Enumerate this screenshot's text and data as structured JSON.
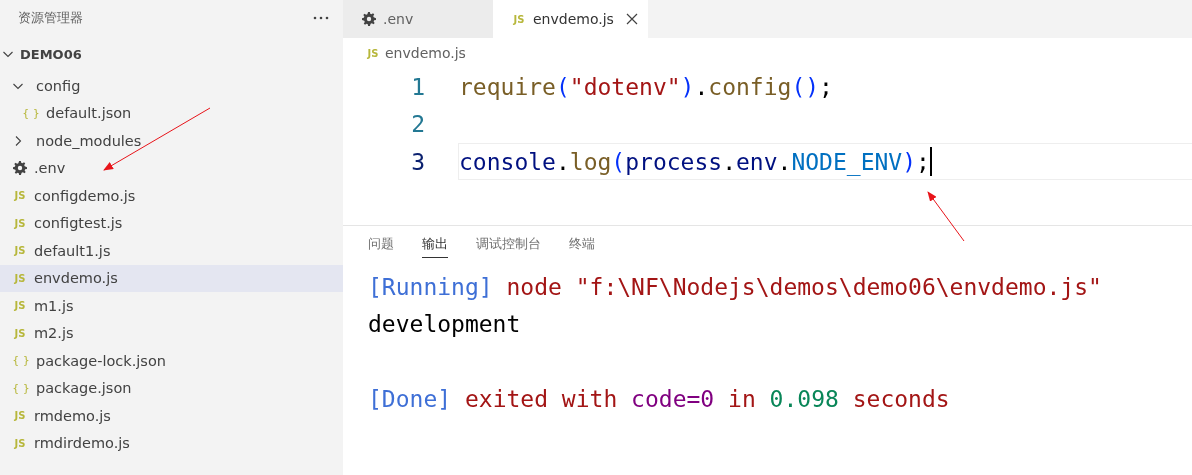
{
  "sidebar": {
    "title": "资源管理器",
    "tree": {
      "label": "DEMO06",
      "expanded": true,
      "children": [
        {
          "label": "config",
          "kind": "folder",
          "expanded": true,
          "selected": false,
          "children": [
            {
              "label": "default.json",
              "kind": "json",
              "icon": "{ }",
              "selected": false
            }
          ]
        },
        {
          "label": "node_modules",
          "kind": "folder",
          "expanded": false,
          "selected": false
        },
        {
          "label": ".env",
          "kind": "env",
          "selected": false
        },
        {
          "label": "configdemo.js",
          "kind": "js",
          "icon": "JS",
          "selected": false
        },
        {
          "label": "configtest.js",
          "kind": "js",
          "icon": "JS",
          "selected": false
        },
        {
          "label": "default1.js",
          "kind": "js",
          "icon": "JS",
          "selected": false
        },
        {
          "label": "envdemo.js",
          "kind": "js",
          "icon": "JS",
          "selected": true
        },
        {
          "label": "m1.js",
          "kind": "js",
          "icon": "JS",
          "selected": false
        },
        {
          "label": "m2.js",
          "kind": "js",
          "icon": "JS",
          "selected": false
        },
        {
          "label": "package-lock.json",
          "kind": "json",
          "icon": "{ }",
          "selected": false
        },
        {
          "label": "package.json",
          "kind": "json",
          "icon": "{ }",
          "selected": false
        },
        {
          "label": "rmdemo.js",
          "kind": "js",
          "icon": "JS",
          "selected": false
        },
        {
          "label": "rmdirdemo.js",
          "kind": "js",
          "icon": "JS",
          "selected": false
        }
      ]
    }
  },
  "editor": {
    "tabs": [
      {
        "label": ".env",
        "kind": "env",
        "selected": false
      },
      {
        "label": "envdemo.js",
        "kind": "js",
        "icon": "JS",
        "selected": true
      }
    ],
    "breadcrumb": {
      "label": "envdemo.js",
      "kind": "js",
      "icon": "JS"
    },
    "lines": [
      {
        "number": "1",
        "current": false,
        "tokens": [
          {
            "text": "require",
            "kind": "function"
          },
          {
            "text": "(",
            "kind": "paren"
          },
          {
            "text": "\"dotenv\"",
            "kind": "string"
          },
          {
            "text": ")",
            "kind": "paren"
          },
          {
            "text": ".",
            "kind": "punct"
          },
          {
            "text": "config",
            "kind": "function"
          },
          {
            "text": "()",
            "kind": "paren"
          },
          {
            "text": ";",
            "kind": "punct"
          }
        ]
      },
      {
        "number": "2",
        "current": false
      },
      {
        "number": "3",
        "current": true,
        "tokens": [
          {
            "text": "console",
            "kind": "variable"
          },
          {
            "text": ".",
            "kind": "punct"
          },
          {
            "text": "log",
            "kind": "function"
          },
          {
            "text": "(",
            "kind": "paren"
          },
          {
            "text": "process",
            "kind": "variable"
          },
          {
            "text": ".",
            "kind": "punct"
          },
          {
            "text": "env",
            "kind": "variable"
          },
          {
            "text": ".",
            "kind": "punct"
          },
          {
            "text": "NODE_ENV",
            "kind": "constant"
          },
          {
            "text": ")",
            "kind": "paren"
          },
          {
            "text": ";",
            "kind": "punct"
          }
        ]
      }
    ]
  },
  "panel": {
    "tabs": [
      {
        "label": "问题",
        "selected": false
      },
      {
        "label": "输出",
        "selected": true
      },
      {
        "label": "调试控制台",
        "selected": false
      },
      {
        "label": "终端",
        "selected": false
      }
    ],
    "output": [
      {
        "tokens": [
          {
            "text": "[Running]",
            "kind": "tag"
          },
          {
            "text": " node \"f:\\NF\\Nodejs\\demos\\demo06\\envdemo.js\"",
            "kind": "text"
          }
        ]
      },
      {
        "tokens": [
          {
            "text": "development",
            "kind": "plain"
          }
        ]
      },
      {
        "blank": true
      },
      {
        "tokens": [
          {
            "text": "[Done]",
            "kind": "tag"
          },
          {
            "text": " exited with ",
            "kind": "text"
          },
          {
            "text": "code=0",
            "kind": "keyword"
          },
          {
            "text": " in ",
            "kind": "text"
          },
          {
            "text": "0.098",
            "kind": "number"
          },
          {
            "text": " seconds",
            "kind": "text"
          }
        ]
      }
    ]
  }
}
